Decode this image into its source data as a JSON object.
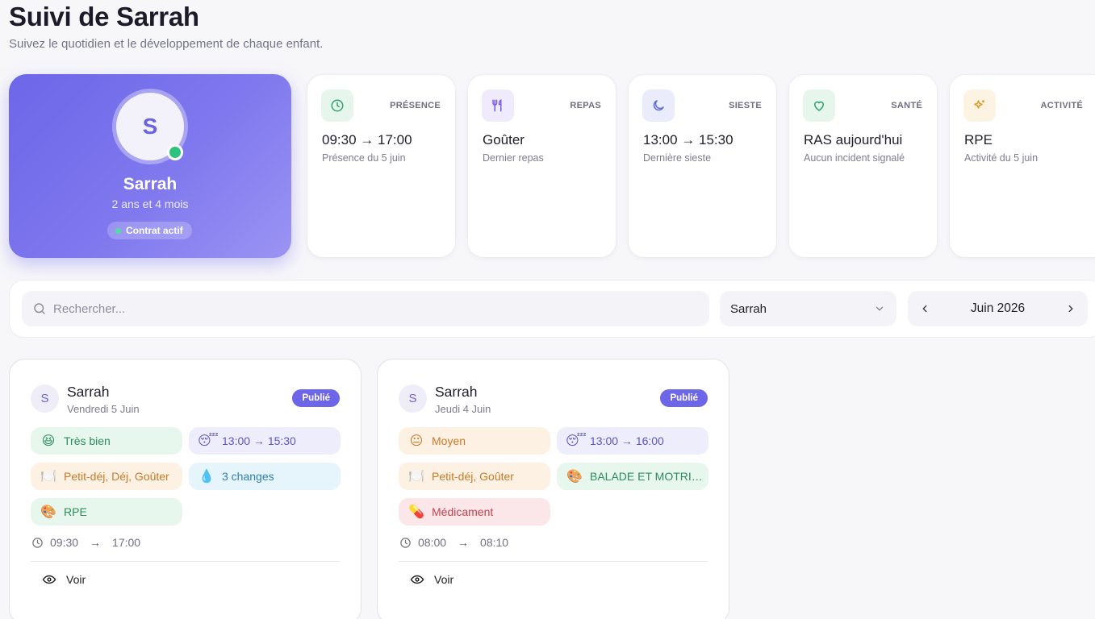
{
  "header": {
    "title": "Suivi de Sarrah",
    "subtitle": "Suivez le quotidien et le développement de chaque enfant."
  },
  "profile": {
    "initial": "S",
    "name": "Sarrah",
    "age": "2 ans et 4 mois",
    "contract": "Contrat actif",
    "colors": {
      "gradient_start": "#6d66e8",
      "gradient_end": "#9b94f3",
      "online": "#2ec27e"
    }
  },
  "stats": [
    {
      "label": "PRÉSENCE",
      "value": "09:30 → 17:00",
      "sub": "Présence du 5 juin",
      "icon": "clock-icon",
      "color": "#2fa36b"
    },
    {
      "label": "REPAS",
      "value": "Goûter",
      "sub": "Dernier repas",
      "icon": "utensils-icon",
      "color": "#7a5be0"
    },
    {
      "label": "SIESTE",
      "value": "13:00 → 15:30",
      "sub": "Dernière sieste",
      "icon": "moon-icon",
      "color": "#5b6bd8"
    },
    {
      "label": "SANTÉ",
      "value": "RAS aujourd'hui",
      "sub": "Aucun incident signalé",
      "icon": "heart-icon",
      "color": "#2fa36b"
    },
    {
      "label": "ACTIVITÉ",
      "value": "RPE",
      "sub": "Activité du 5 juin",
      "icon": "sparkles-icon",
      "color": "#e09a2a"
    }
  ],
  "filters": {
    "search_placeholder": "Rechercher...",
    "child_selected": "Sarrah",
    "month": "Juin 2026"
  },
  "days": [
    {
      "initial": "S",
      "name": "Sarrah",
      "date": "Vendredi 5 Juin",
      "status": "Publié",
      "chips": [
        {
          "emoji": "😆",
          "text": "Très bien",
          "tone": "green"
        },
        {
          "emoji": "😴",
          "text": "13:00 → 15:30",
          "tone": "purple"
        },
        {
          "emoji": "🍽️",
          "text": "Petit-déj, Déj, Goûter",
          "tone": "orange"
        },
        {
          "emoji": "💧",
          "text": "3 changes",
          "tone": "blue"
        },
        {
          "emoji": "🎨",
          "text": "RPE",
          "tone": "green"
        }
      ],
      "arrival": "09:30",
      "departure": "17:00",
      "arrow": "→",
      "view_label": "Voir"
    },
    {
      "initial": "S",
      "name": "Sarrah",
      "date": "Jeudi 4 Juin",
      "status": "Publié",
      "chips": [
        {
          "emoji": "😐",
          "text": "Moyen",
          "tone": "orange"
        },
        {
          "emoji": "😴",
          "text": "13:00 → 16:00",
          "tone": "purple"
        },
        {
          "emoji": "🍽️",
          "text": "Petit-déj, Goûter",
          "tone": "orange"
        },
        {
          "emoji": "🎨",
          "text": "BALADE ET MOTRICITÉ",
          "tone": "green"
        },
        {
          "emoji": "💊",
          "text": "Médicament",
          "tone": "red"
        }
      ],
      "arrival": "08:00",
      "departure": "08:10",
      "arrow": "→",
      "view_label": "Voir"
    }
  ]
}
